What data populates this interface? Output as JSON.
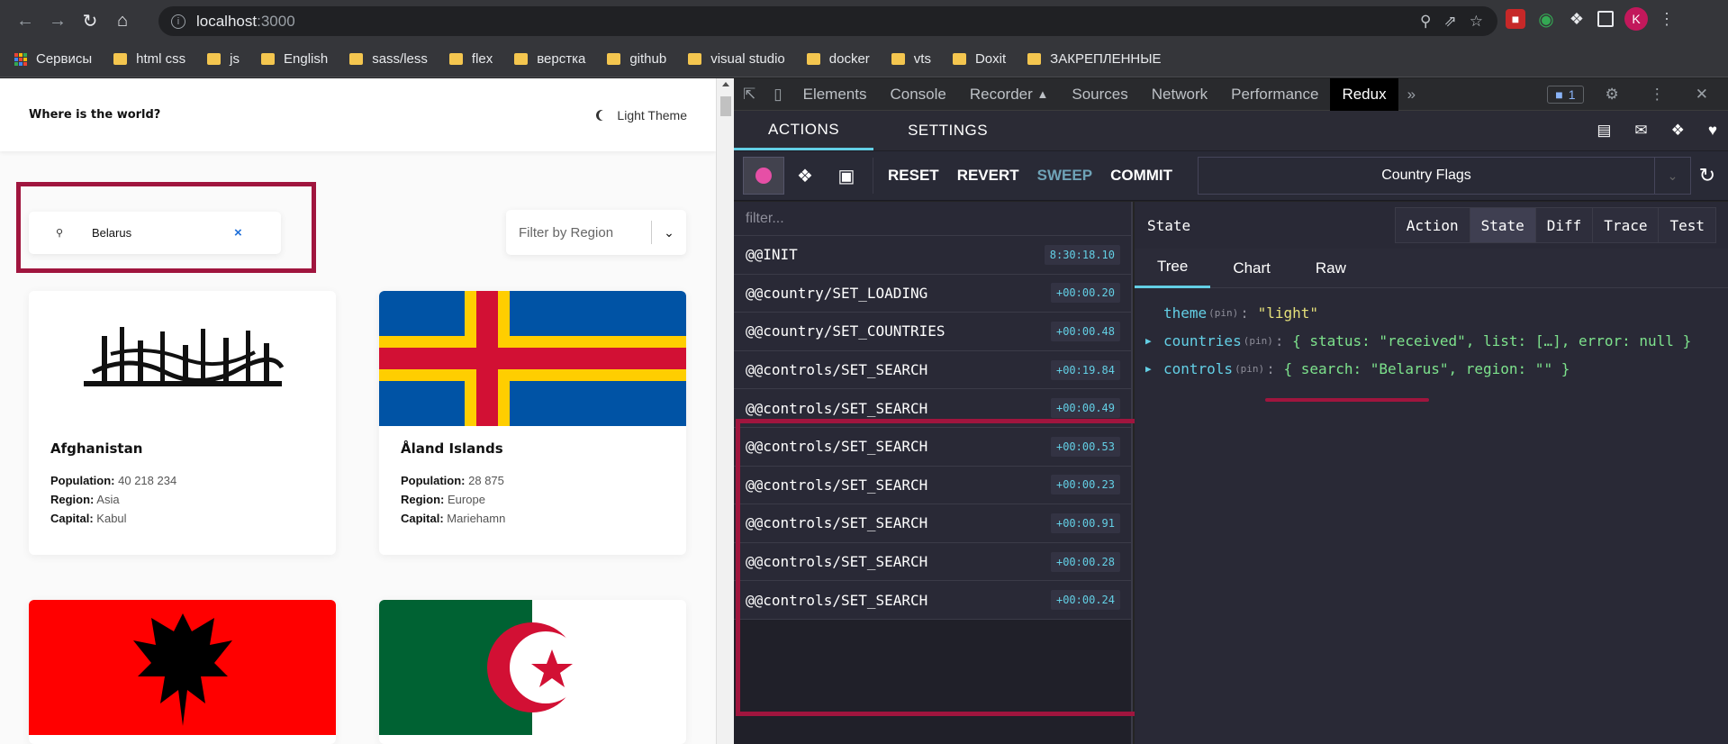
{
  "browser": {
    "url_host": "localhost",
    "url_port": ":3000",
    "avatar_letter": "K"
  },
  "bookmarks": [
    {
      "label": "Сервисы",
      "type": "apps"
    },
    {
      "label": "html css",
      "type": "folder"
    },
    {
      "label": "js",
      "type": "folder"
    },
    {
      "label": "English",
      "type": "folder"
    },
    {
      "label": "sass/less",
      "type": "folder"
    },
    {
      "label": "flex",
      "type": "folder"
    },
    {
      "label": "верстка",
      "type": "folder"
    },
    {
      "label": "github",
      "type": "folder"
    },
    {
      "label": "visual studio",
      "type": "folder"
    },
    {
      "label": "docker",
      "type": "folder"
    },
    {
      "label": "vts",
      "type": "folder"
    },
    {
      "label": "Doxit",
      "type": "folder"
    },
    {
      "label": "ЗАКРЕПЛЕННЫЕ",
      "type": "folder"
    }
  ],
  "app": {
    "title": "Where is the world?",
    "theme_label": "Light Theme",
    "search_value": "Belarus",
    "filter_placeholder": "Filter by Region",
    "cards": [
      {
        "name": "Afghanistan",
        "population": "40 218 234",
        "region": "Asia",
        "capital": "Kabul"
      },
      {
        "name": "Åland Islands",
        "population": "28 875",
        "region": "Europe",
        "capital": "Mariehamn"
      }
    ],
    "labels": {
      "population": "Population:",
      "region": "Region:",
      "capital": "Capital:"
    }
  },
  "devtools": {
    "tabs": [
      "Elements",
      "Console",
      "Recorder",
      "Sources",
      "Network",
      "Performance",
      "Redux"
    ],
    "active_tab": "Redux",
    "messages_count": "1"
  },
  "redux": {
    "tabs": [
      "ACTIONS",
      "SETTINGS"
    ],
    "buttons": {
      "reset": "RESET",
      "revert": "REVERT",
      "sweep": "SWEEP",
      "commit": "COMMIT"
    },
    "instance": "Country Flags",
    "filter_placeholder": "filter...",
    "actions": [
      {
        "name": "@@INIT",
        "time": "8:30:18.10"
      },
      {
        "name": "@@country/SET_LOADING",
        "time": "+00:00.20"
      },
      {
        "name": "@@country/SET_COUNTRIES",
        "time": "+00:00.48"
      },
      {
        "name": "@@controls/SET_SEARCH",
        "time": "+00:19.84"
      },
      {
        "name": "@@controls/SET_SEARCH",
        "time": "+00:00.49"
      },
      {
        "name": "@@controls/SET_SEARCH",
        "time": "+00:00.53"
      },
      {
        "name": "@@controls/SET_SEARCH",
        "time": "+00:00.23"
      },
      {
        "name": "@@controls/SET_SEARCH",
        "time": "+00:00.91"
      },
      {
        "name": "@@controls/SET_SEARCH",
        "time": "+00:00.28"
      },
      {
        "name": "@@controls/SET_SEARCH",
        "time": "+00:00.24"
      }
    ],
    "state_title": "State",
    "view_tabs": [
      "Action",
      "State",
      "Diff",
      "Trace",
      "Test"
    ],
    "active_view": "State",
    "sub_tabs": [
      "Tree",
      "Chart",
      "Raw"
    ],
    "active_sub": "Tree",
    "tree": {
      "theme_key": "theme",
      "theme_val": "\"light\"",
      "countries_key": "countries",
      "countries_val": "{ status: \"received\", list: […], error: null }",
      "controls_key": "controls",
      "controls_val": "{ search: \"Belarus\", region: \"\" }",
      "pin": "(pin)"
    }
  },
  "colors": {
    "highlight": "#a0153e",
    "accent": "#63cfe5"
  }
}
